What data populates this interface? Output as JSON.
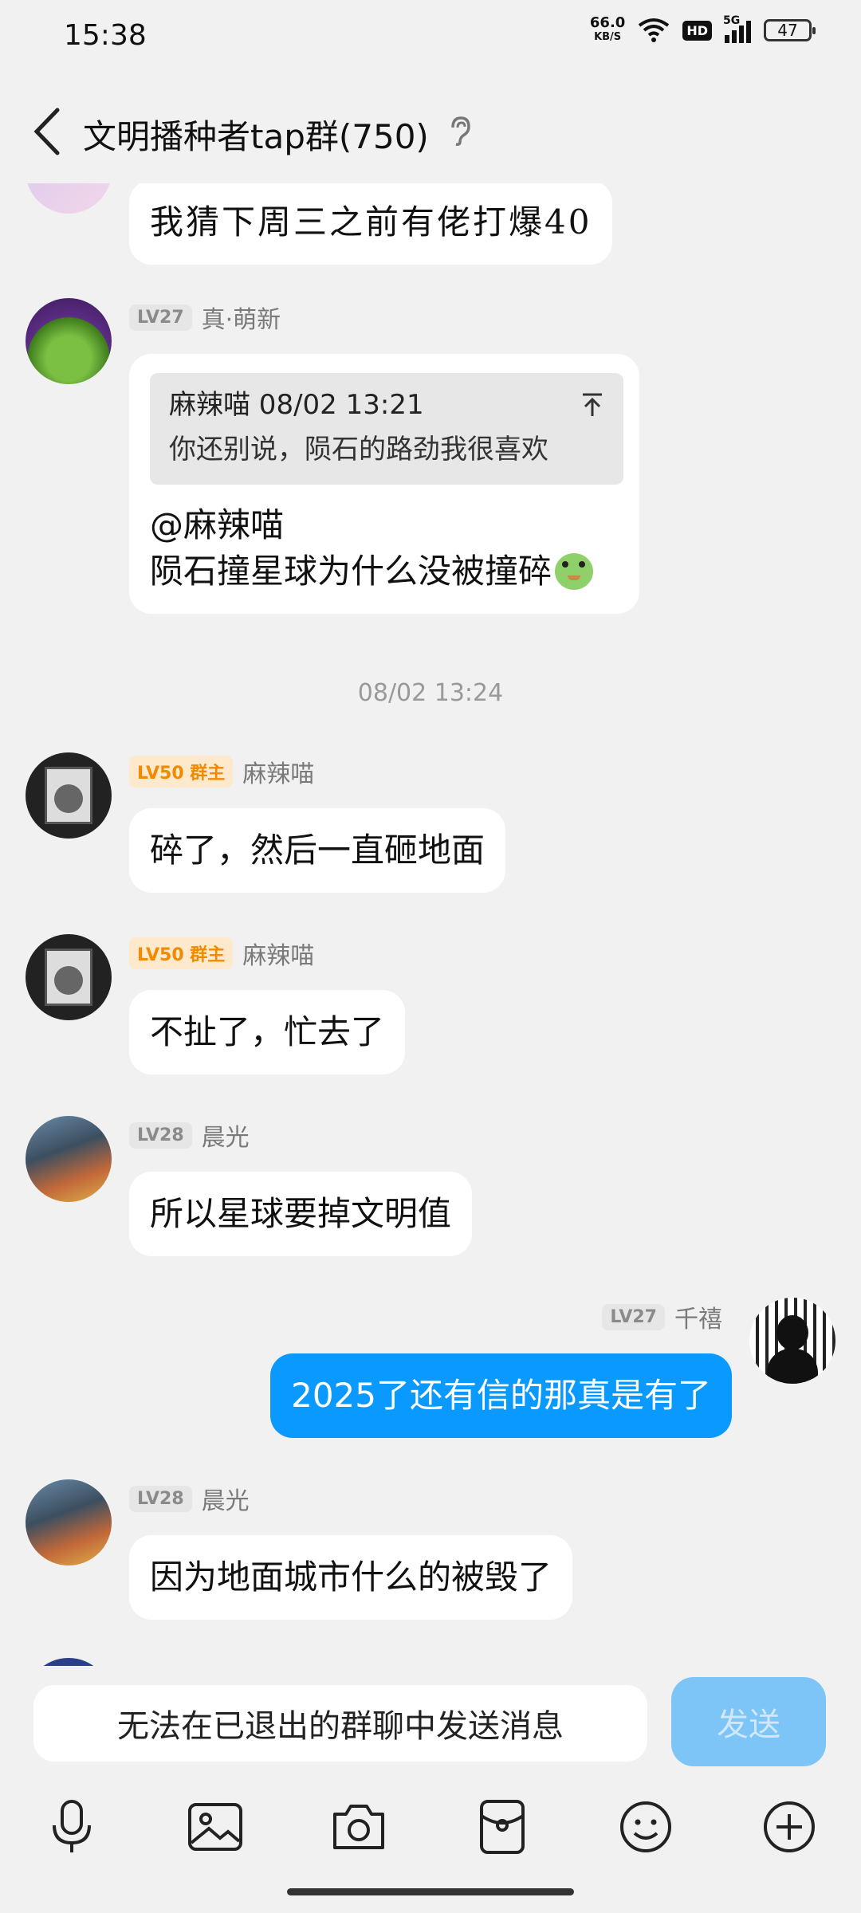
{
  "status_bar": {
    "time": "15:38",
    "net_speed": "66.0",
    "net_unit": "KB/S",
    "hd": "HD",
    "signal": "5G",
    "battery": "47"
  },
  "header": {
    "title": "文明播种者tap群(750)"
  },
  "messages": [
    {
      "id": "m0",
      "text": "我猜下周三之前有佬打爆40"
    },
    {
      "id": "m1",
      "level": "LV27",
      "name": "真·萌新",
      "quote": {
        "author_time": "麻辣喵 08/02 13:21",
        "text": "你还别说，陨石的路劲我很喜欢"
      },
      "line1": "@麻辣喵",
      "line2": "陨石撞星球为什么没被撞碎"
    },
    {
      "id": "ts",
      "timestamp": "08/02 13:24"
    },
    {
      "id": "m2",
      "level": "LV50 群主",
      "name": "麻辣喵",
      "text": "碎了，然后一直砸地面"
    },
    {
      "id": "m3",
      "level": "LV50 群主",
      "name": "麻辣喵",
      "text": "不扯了，忙去了"
    },
    {
      "id": "m4",
      "level": "LV28",
      "name": "晨光",
      "text": "所以星球要掉文明值"
    },
    {
      "id": "m5",
      "level": "LV27",
      "name": "千禧",
      "text": "2025了还有信的那真是有了"
    },
    {
      "id": "m6",
      "level": "LV28",
      "name": "晨光",
      "text": "因为地面城市什么的被毁了"
    }
  ],
  "input": {
    "placeholder": "无法在已退出的群聊中发送消息",
    "send_label": "发送"
  },
  "toolbar_icons": [
    "microphone-icon",
    "image-icon",
    "camera-icon",
    "red-packet-icon",
    "emoji-icon",
    "plus-icon"
  ],
  "colors": {
    "accent": "#0a99ff",
    "owner_badge": "#f08a00",
    "send_disabled": "#7dc4f7"
  }
}
